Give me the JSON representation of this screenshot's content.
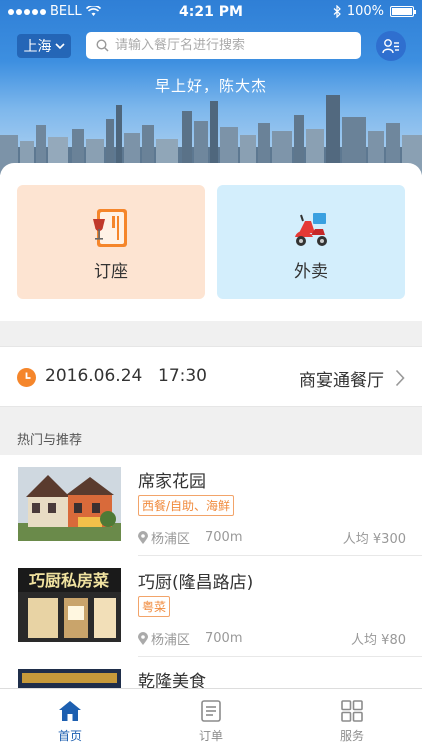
{
  "status_bar": {
    "carrier": "BELL",
    "time": "4:21 PM",
    "battery": "100%"
  },
  "header": {
    "city": "上海",
    "search_placeholder": "请输入餐厅名进行搜索",
    "greeting": "早上好，陈大杰"
  },
  "tiles": [
    {
      "label": "订座",
      "icon": "menu-wine-icon",
      "bg": "#fde4d2"
    },
    {
      "label": "外卖",
      "icon": "scooter-icon",
      "bg": "#d3eefc"
    }
  ],
  "booking": {
    "date": "2016.06.24",
    "time": "17:30",
    "restaurant": "商宴通餐厅"
  },
  "section_title": "热门与推荐",
  "restaurants": [
    {
      "name": "席家花园",
      "tags": [
        "西餐/自助、海鲜"
      ],
      "district": "杨浦区",
      "distance": "700m",
      "price": "人均 ¥300"
    },
    {
      "name": "巧厨(隆昌路店)",
      "tags": [
        "粤菜"
      ],
      "district": "杨浦区",
      "distance": "700m",
      "price": "人均 ¥80"
    },
    {
      "name": "乾隆美食",
      "tags": [],
      "district": "",
      "distance": "",
      "price": ""
    }
  ],
  "thumb_text": {
    "r2": "巧厨私房菜"
  },
  "tabbar": [
    {
      "label": "首页",
      "icon": "home-icon",
      "active": true
    },
    {
      "label": "订单",
      "icon": "list-icon",
      "active": false
    },
    {
      "label": "服务",
      "icon": "grid-icon",
      "active": false
    }
  ],
  "colors": {
    "accent_blue": "#1d5fb0",
    "tag_orange": "#f08a3c",
    "clock_orange": "#f5862b"
  }
}
